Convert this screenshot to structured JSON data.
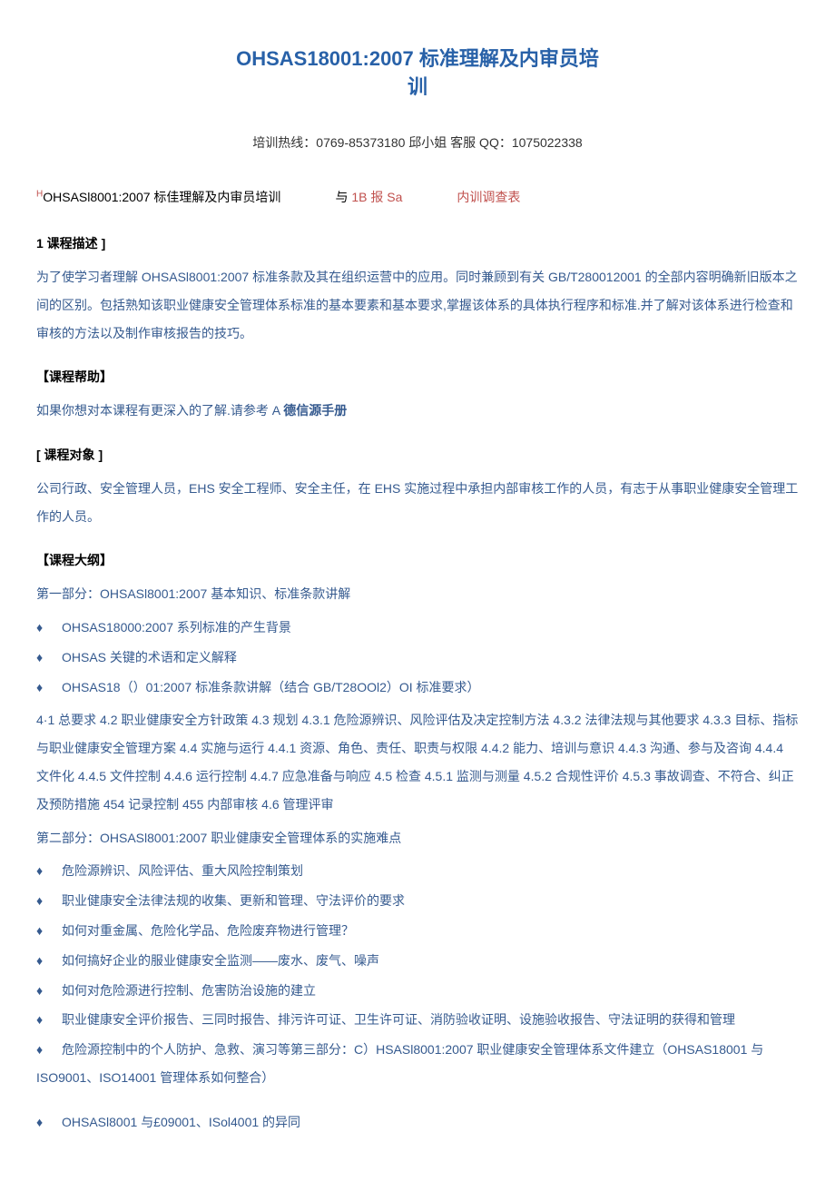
{
  "title_line1": "OHSAS18001:2007 标准理解及内审员培",
  "title_line2": "训",
  "hotline": "培训热线：0769-85373180 邱小姐 客服 QQ：1075022338",
  "toprow": {
    "sup": "H",
    "left": "OHSASl8001:2007 标佳理解及内审员培训",
    "mid_prefix": "与",
    "mid_red": " 1B 报 Sa",
    "right": "内训调查表"
  },
  "sec_desc_label": "1 课程描述 ]",
  "desc_para": "为了使学习者理解 OHSASl8001:2007 标准条款及其在组织运营中的应用。同时兼顾到有关 GB/T280012001 的全部内容明确新旧版本之间的区别。包括熟知该职业健康安全管理体系标准的基本要素和基本要求,掌握该体系的具体执行程序和标准.并了解对该体系进行检查和审核的方法以及制作审核报告的技巧。",
  "help_label": "【课程帮助】",
  "help_text_prefix": "如果你想对本课程有更深入的了解.请参考 A ",
  "help_link": "德信源手册",
  "audience_label": "[ 课程对象 ]",
  "audience_para": "公司行政、安全管理人员，EHS 安全工程师、安全主任，在 EHS 实施过程中承担内部审核工作的人员，有志于从事职业健康安全管理工作的人员。",
  "outline_label": "【课程大纲】",
  "part1_title": "第一部分：OHSASl8001:2007 基本知识、标准条款讲解",
  "part1_items": [
    "OHSAS18000:2007 系列标准的产生背景",
    "OHSAS 关键的术语和定义解释",
    "OHSAS18（）01:2007 标准条款讲解（结合 GB/T28OOl2）OI 标准要求）"
  ],
  "part1_detail": "4·1 总要求 4.2 职业健康安全方针政策 4.3 规划 4.3.1 危险源辨识、风险评估及决定控制方法 4.3.2 法律法规与其他要求 4.3.3 目标、指标与职业健康安全管理方案 4.4 实施与运行 4.4.1 资源、角色、责任、职责与权限 4.4.2 能力、培训与意识 4.4.3 沟通、参与及咨询 4.4.4 文件化 4.4.5 文件控制 4.4.6 运行控制 4.4.7 应急准备与响应 4.5 检查 4.5.1 监测与测量 4.5.2 合规性评价 4.5.3 事故调查、不符合、纠正及预防措施 454 记录控制 455 内部审核 4.6 管理评审",
  "part2_title": "第二部分：OHSASl8001:2007 职业健康安全管理体系的实施难点",
  "part2_items": [
    "危险源辨识、风险评估、重大风险控制策划",
    "职业健康安全法律法规的收集、更新和管理、守法评价的要求",
    "如何对重金属、危险化学品、危险废弃物进行管理？",
    "如何搞好企业的服业健康安全监测——废水、废气、噪声",
    "如何对危险源进行控制、危害防治设施的建立",
    "职业健康安全评价报告、三同时报告、排污许可证、卫生许可证、消防验收证明、设施验收报告、守法证明的获得和管理",
    "危险源控制中的个人防护、急救、演习等第三部分：C）HSASl8001:2007 职业健康安全管理体系文件建立（OHSAS18001 与 ISO9001、ISO14001 管理体系如何整合）"
  ],
  "part3_items": [
    "OHSASl8001 与£09001、ISol4001 的异同"
  ]
}
